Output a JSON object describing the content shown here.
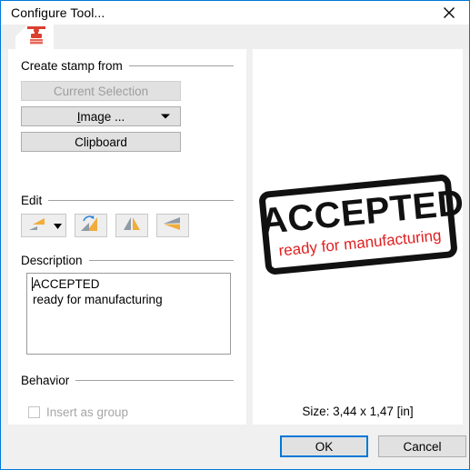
{
  "window": {
    "title": "Configure Tool...",
    "close_icon": "close-icon",
    "accent_color": "#0078d7"
  },
  "tabs": [
    {
      "icon": "stamp-icon",
      "label": ""
    }
  ],
  "create_stamp_from": {
    "group_label": "Create stamp from",
    "buttons": [
      {
        "label": "Current Selection",
        "disabled": true,
        "has_dropdown": false
      },
      {
        "label": "Image ...",
        "accel": "I",
        "disabled": false,
        "has_dropdown": true
      },
      {
        "label": "Clipboard",
        "disabled": false,
        "has_dropdown": false
      }
    ]
  },
  "edit": {
    "group_label": "Edit",
    "tools": [
      {
        "name": "resize-tool",
        "has_dropdown": true
      },
      {
        "name": "rotate-tool",
        "has_dropdown": false
      },
      {
        "name": "flip-vertical-tool",
        "has_dropdown": false
      },
      {
        "name": "flip-horizontal-tool",
        "has_dropdown": false
      }
    ]
  },
  "description": {
    "group_label": "Description",
    "value": "ACCEPTED\nready for manufacturing",
    "placeholder": ""
  },
  "behavior": {
    "group_label": "Behavior",
    "insert_as_group": {
      "label": "Insert as group",
      "checked": false,
      "disabled": true
    }
  },
  "preview": {
    "stamp_main_text": "ACCEPTED",
    "stamp_sub_text": "ready for manufacturing",
    "stamp_main_color": "#111111",
    "stamp_sub_color": "#e02020",
    "size_label": "Size: 3,44 x 1,47 [in]"
  },
  "footer": {
    "ok_label": "OK",
    "cancel_label": "Cancel"
  }
}
